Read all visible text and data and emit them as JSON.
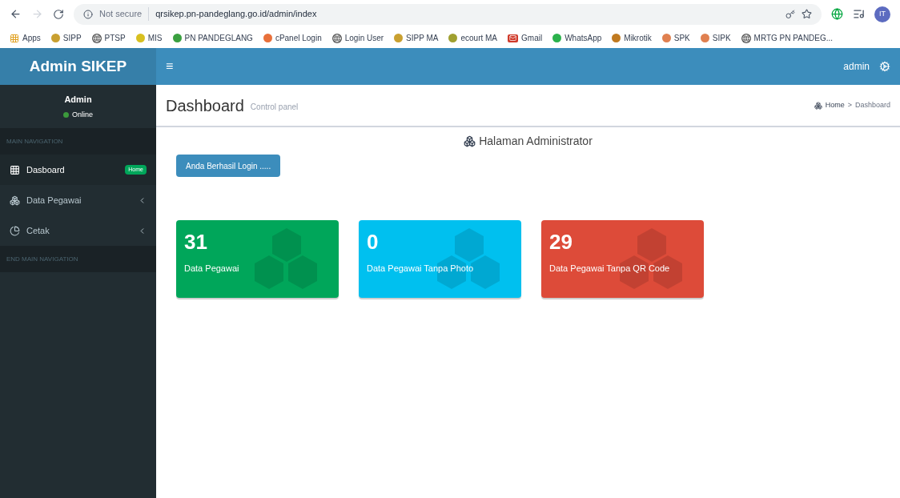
{
  "browser": {
    "security": "Not secure",
    "url": "qrsikep.pn-pandeglang.go.id/admin/index",
    "bookmarks": [
      {
        "kind": "grid",
        "label": "Apps",
        "color": "#e0a020"
      },
      {
        "kind": "dot",
        "label": "SIPP",
        "color": "#c9a030"
      },
      {
        "kind": "globe",
        "label": "PTSP",
        "color": "#555555"
      },
      {
        "kind": "dot",
        "label": "MIS",
        "color": "#d8c020"
      },
      {
        "kind": "dot",
        "label": "PN PANDEGLANG",
        "color": "#3aa040"
      },
      {
        "kind": "dot",
        "label": "cPanel Login",
        "color": "#e8703a"
      },
      {
        "kind": "globe",
        "label": "Login User",
        "color": "#555555"
      },
      {
        "kind": "dot",
        "label": "SIPP MA",
        "color": "#c9a030"
      },
      {
        "kind": "dot",
        "label": "ecourt MA",
        "color": "#a0a030"
      },
      {
        "kind": "mail",
        "label": "Gmail",
        "color": "#d03a2a"
      },
      {
        "kind": "dot",
        "label": "WhatsApp",
        "color": "#2bb24c"
      },
      {
        "kind": "dot",
        "label": "Mikrotik",
        "color": "#c07a20"
      },
      {
        "kind": "dot",
        "label": "SPK",
        "color": "#e08050"
      },
      {
        "kind": "dot",
        "label": "SIPK",
        "color": "#e08050"
      },
      {
        "kind": "globe",
        "label": "MRTG PN PANDEG...",
        "color": "#555555"
      }
    ],
    "profile_initials": "IT"
  },
  "header": {
    "logo": "Admin SIKEP",
    "menu_glyph": "≡",
    "user": "admin"
  },
  "sidebar": {
    "user": {
      "name": "Admin",
      "status": "Online"
    },
    "items": [
      {
        "kind": "heading",
        "label": "MAIN NAVIGATION"
      },
      {
        "kind": "link",
        "label": "Dasboard",
        "badge": "Home",
        "selected": true,
        "expandable": false
      },
      {
        "kind": "link",
        "label": "Data Pegawai",
        "selected": false,
        "expandable": true
      },
      {
        "kind": "link",
        "label": "Cetak",
        "selected": false,
        "expandable": true
      },
      {
        "kind": "heading",
        "label": "END MAIN NAVIGATION"
      }
    ]
  },
  "content": {
    "title": "Dashboard",
    "subtitle": "Control panel",
    "breadcrumb": [
      "Home",
      "Dashboard"
    ],
    "breadcrumb_separator": ">",
    "panel_title": "Halaman Administrator",
    "login_button": "Anda Berhasil Login .....",
    "stats": [
      {
        "value": "31",
        "label": "Data Pegawai",
        "color": "#00a65a"
      },
      {
        "value": "0",
        "label": "Data Pegawai Tanpa Photo",
        "color": "#00c0ef"
      },
      {
        "value": "29",
        "label": "Data Pegawai Tanpa QR Code",
        "color": "#dd4b39"
      }
    ]
  }
}
